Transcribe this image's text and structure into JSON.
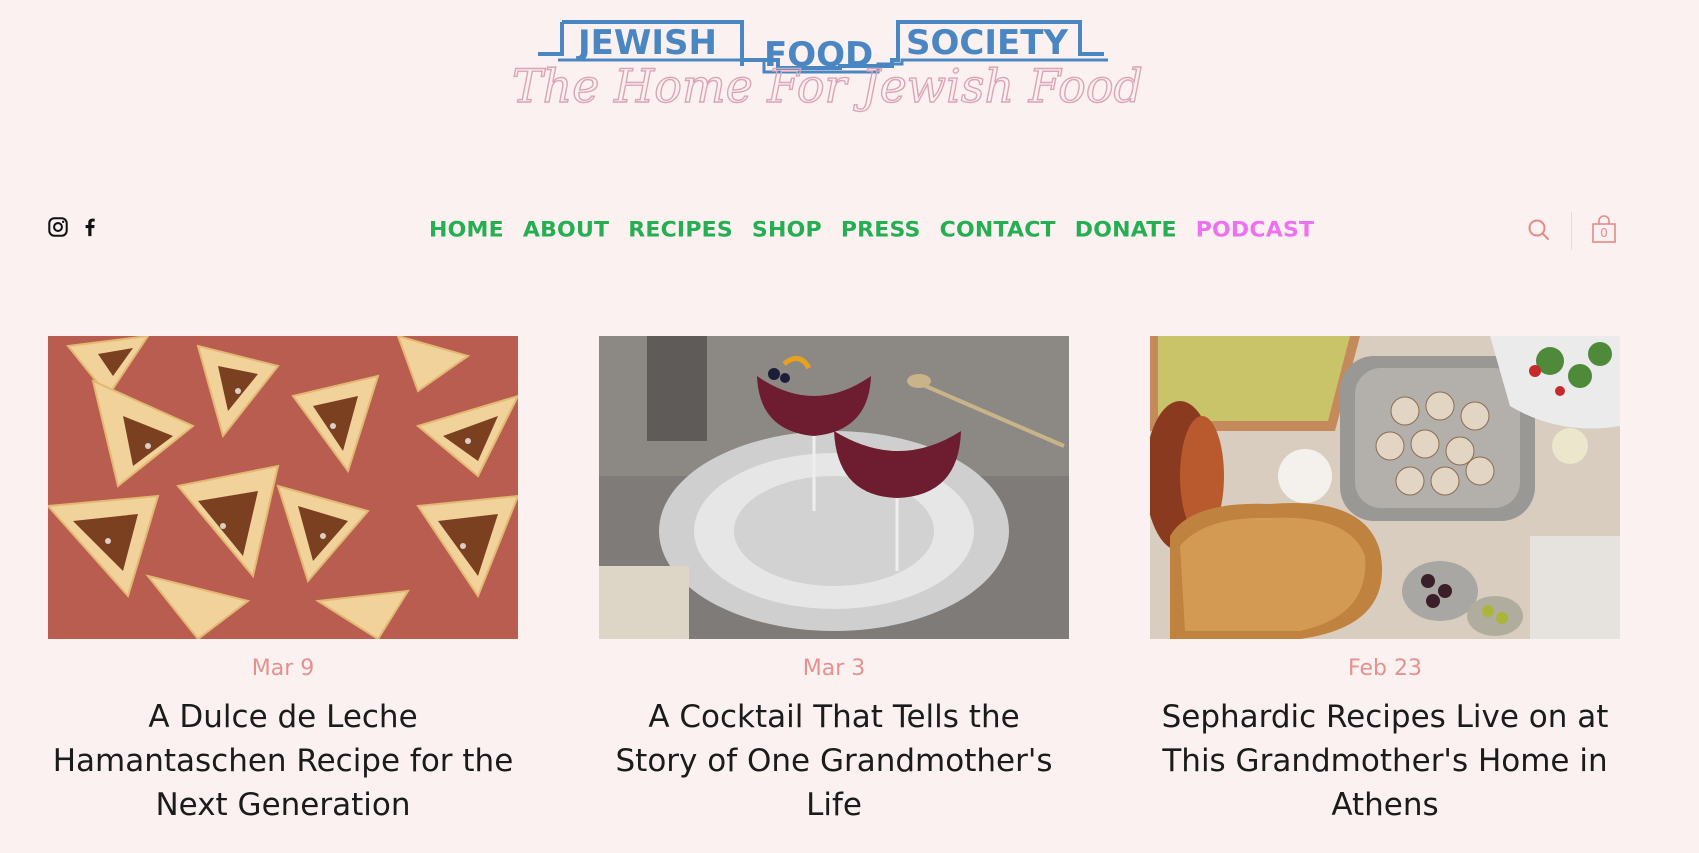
{
  "brand": {
    "logo_words": [
      "JEWISH",
      "FOOD",
      "SOCIETY"
    ],
    "tagline": "The Home For Jewish Food",
    "logo_color": "#4a87c2",
    "tagline_color": "#dba5b8"
  },
  "social": [
    {
      "name": "instagram-icon"
    },
    {
      "name": "facebook-icon"
    }
  ],
  "nav": [
    {
      "label": "HOME"
    },
    {
      "label": "ABOUT"
    },
    {
      "label": "RECIPES"
    },
    {
      "label": "SHOP"
    },
    {
      "label": "PRESS"
    },
    {
      "label": "CONTACT"
    },
    {
      "label": "DONATE"
    },
    {
      "label": "PODCAST"
    }
  ],
  "nav_color": "#25ae52",
  "nav_highlight_color": "#ec72f0",
  "icons": {
    "search": "search-icon",
    "cart": "shopping-bag-icon"
  },
  "cart": {
    "count": "0"
  },
  "posts": [
    {
      "date": "Mar 9",
      "title": "A Dulce de Leche Hamantaschen Recipe for the Next Generation",
      "image": "hamantaschen-cookies-image"
    },
    {
      "date": "Mar 3",
      "title": "A Cocktail That Tells the Story of One Grandmother's Life",
      "image": "cocktail-glasses-image"
    },
    {
      "date": "Feb 23",
      "title": "Sephardic Recipes Live on at This Grandmother's Home in Athens",
      "image": "sephardic-table-spread-image"
    }
  ],
  "colors": {
    "background": "#fbf1f0",
    "date": "#e3928f",
    "accent_line": "#4a7fae"
  }
}
